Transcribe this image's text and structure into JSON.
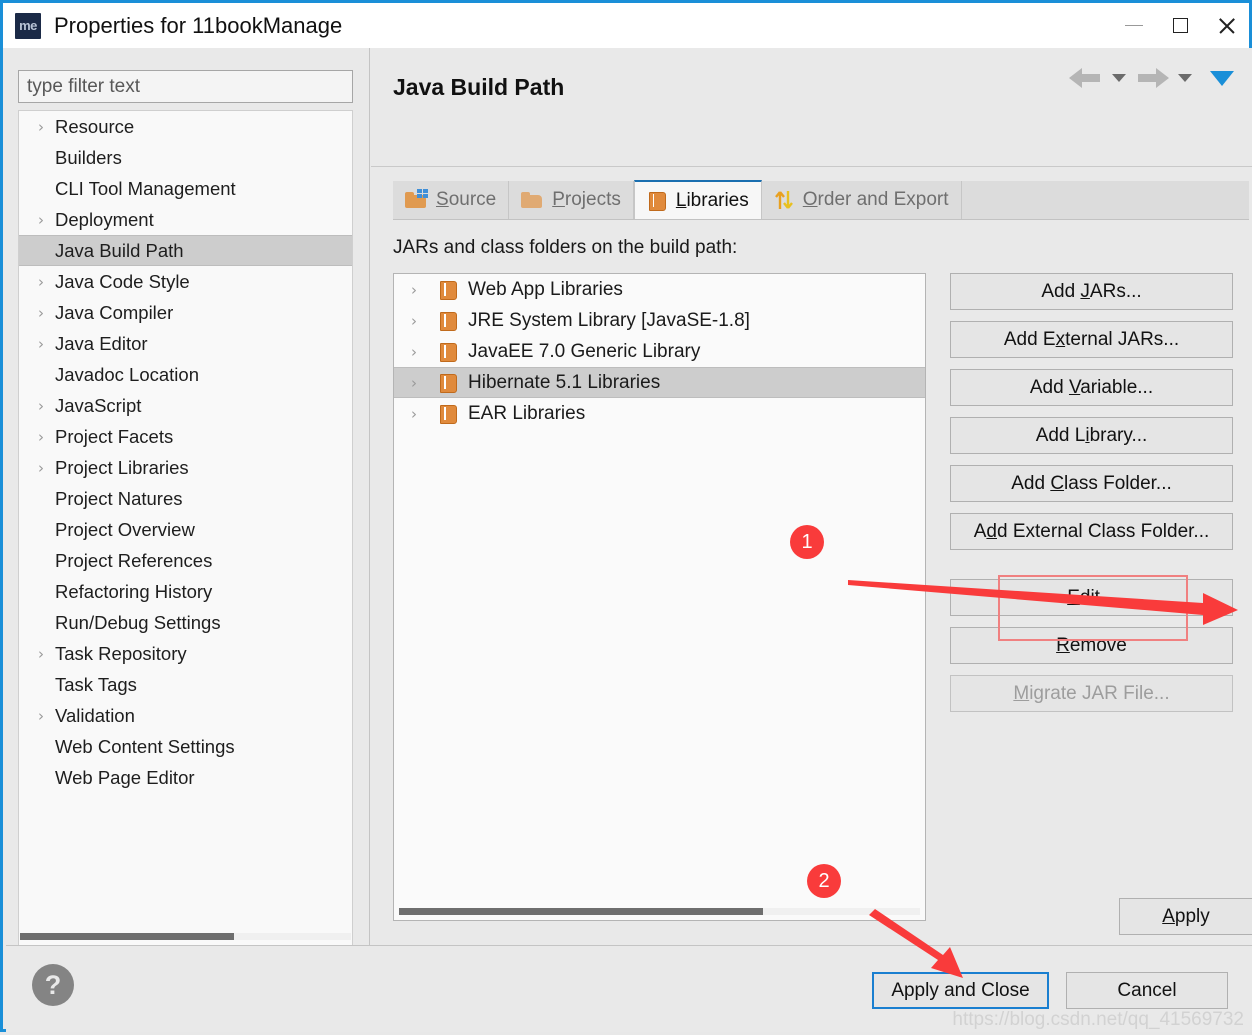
{
  "window": {
    "title": "Properties for 11bookManage",
    "app_icon": "me",
    "controls": {
      "minimize": "minimize-icon",
      "maximize": "maximize-icon",
      "close": "close-icon"
    },
    "border_color": "#1a8fd8"
  },
  "sidebar": {
    "filter": {
      "placeholder": "type filter text",
      "value": ""
    },
    "items": [
      {
        "label": "Resource",
        "expandable": true,
        "selected": false
      },
      {
        "label": "Builders",
        "expandable": false,
        "selected": false
      },
      {
        "label": "CLI Tool Management",
        "expandable": false,
        "selected": false
      },
      {
        "label": "Deployment",
        "expandable": true,
        "selected": false
      },
      {
        "label": "Java Build Path",
        "expandable": false,
        "selected": true
      },
      {
        "label": "Java Code Style",
        "expandable": true,
        "selected": false
      },
      {
        "label": "Java Compiler",
        "expandable": true,
        "selected": false
      },
      {
        "label": "Java Editor",
        "expandable": true,
        "selected": false
      },
      {
        "label": "Javadoc Location",
        "expandable": false,
        "selected": false
      },
      {
        "label": "JavaScript",
        "expandable": true,
        "selected": false
      },
      {
        "label": "Project Facets",
        "expandable": true,
        "selected": false
      },
      {
        "label": "Project Libraries",
        "expandable": true,
        "selected": false
      },
      {
        "label": "Project Natures",
        "expandable": false,
        "selected": false
      },
      {
        "label": "Project Overview",
        "expandable": false,
        "selected": false
      },
      {
        "label": "Project References",
        "expandable": false,
        "selected": false
      },
      {
        "label": "Refactoring History",
        "expandable": false,
        "selected": false
      },
      {
        "label": "Run/Debug Settings",
        "expandable": false,
        "selected": false
      },
      {
        "label": "Task Repository",
        "expandable": true,
        "selected": false
      },
      {
        "label": "Task Tags",
        "expandable": false,
        "selected": false
      },
      {
        "label": "Validation",
        "expandable": true,
        "selected": false
      },
      {
        "label": "Web Content Settings",
        "expandable": false,
        "selected": false
      },
      {
        "label": "Web Page Editor",
        "expandable": false,
        "selected": false
      }
    ]
  },
  "main": {
    "page_title": "Java Build Path",
    "nav": {
      "back": "back-arrow-icon",
      "forward": "forward-arrow-icon",
      "menu": "blue-dropdown-icon"
    },
    "tabs": [
      {
        "label": "Source",
        "mnemonic": "S",
        "icon": "folder-blocks-icon",
        "active": false
      },
      {
        "label": "Projects",
        "mnemonic": "P",
        "icon": "folder-icon",
        "active": false
      },
      {
        "label": "Libraries",
        "mnemonic": "L",
        "icon": "book-icon",
        "active": true
      },
      {
        "label": "Order and Export",
        "mnemonic": "O",
        "icon": "up-down-arrows-icon",
        "active": false
      }
    ],
    "list_caption": "JARs and class folders on the build path:",
    "libraries": [
      {
        "label": "EAR Libraries",
        "selected": false
      },
      {
        "label": "Hibernate 5.1 Libraries",
        "selected": true
      },
      {
        "label": "JavaEE 7.0 Generic Library",
        "selected": false
      },
      {
        "label": "JRE System Library [JavaSE-1.8]",
        "selected": false
      },
      {
        "label": "Web App Libraries",
        "selected": false
      }
    ],
    "side_buttons": [
      {
        "label": "Add JARs...",
        "mnemonic": "J",
        "disabled": false
      },
      {
        "label": "Add External JARs...",
        "mnemonic": "x",
        "disabled": false
      },
      {
        "label": "Add Variable...",
        "mnemonic": "V",
        "disabled": false
      },
      {
        "label": "Add Library...",
        "mnemonic": "i",
        "disabled": false
      },
      {
        "label": "Add Class Folder...",
        "mnemonic": "C",
        "disabled": false
      },
      {
        "label": "Add External Class Folder...",
        "mnemonic": "d",
        "disabled": false
      },
      {
        "label": "Edit...",
        "mnemonic": "E",
        "disabled": false
      },
      {
        "label": "Remove",
        "mnemonic": "R",
        "disabled": false
      },
      {
        "label": "Migrate JAR File...",
        "mnemonic": "M",
        "disabled": true
      }
    ],
    "apply_button": {
      "label": "Apply",
      "mnemonic": "A"
    }
  },
  "footer": {
    "help_icon": "?",
    "apply_and_close": "Apply and Close",
    "cancel": "Cancel",
    "watermark": "https://blog.csdn.net/qq_41569732"
  },
  "annotations": {
    "badge_1": "1",
    "badge_2": "2",
    "highlight_color": "#f08080",
    "arrow_color": "#f93b3b"
  }
}
